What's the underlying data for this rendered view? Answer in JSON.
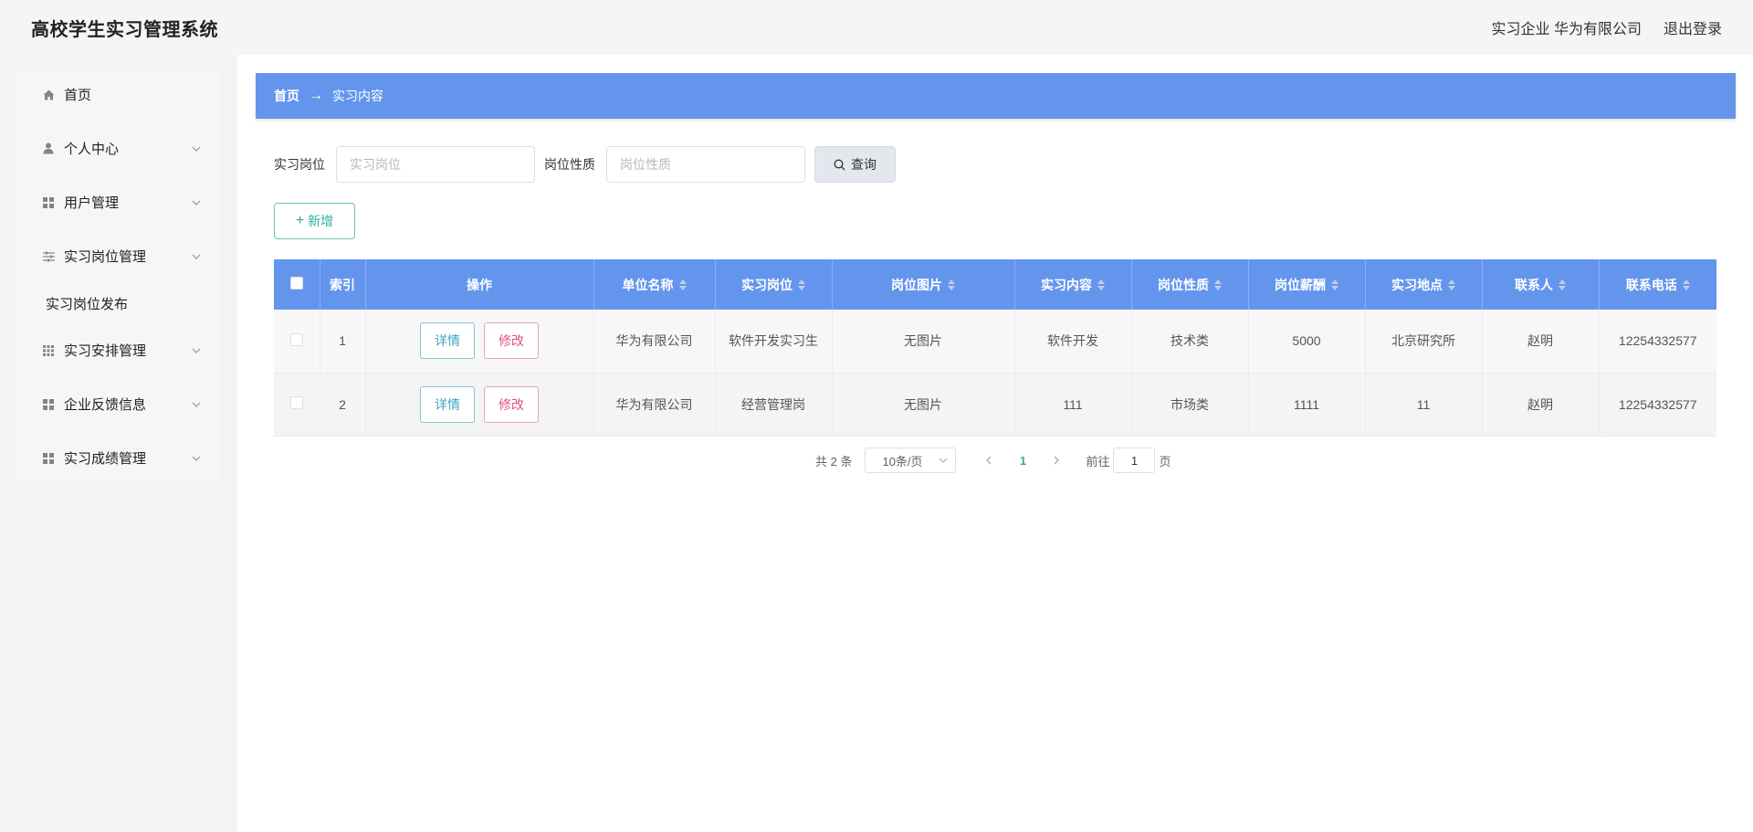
{
  "header": {
    "title": "高校学生实习管理系统",
    "user_info": "实习企业 华为有限公司",
    "logout": "退出登录"
  },
  "sidebar": {
    "items": [
      {
        "label": "首页",
        "icon": "home-icon",
        "has_children": false
      },
      {
        "label": "个人中心",
        "icon": "user-icon",
        "has_children": true
      },
      {
        "label": "用户管理",
        "icon": "grid-icon",
        "has_children": true
      },
      {
        "label": "实习岗位管理",
        "icon": "sliders-icon",
        "has_children": true,
        "expanded": true,
        "children": [
          "实习岗位发布"
        ]
      },
      {
        "label": "实习安排管理",
        "icon": "grid-small-icon",
        "has_children": true
      },
      {
        "label": "企业反馈信息",
        "icon": "grid-icon",
        "has_children": true
      },
      {
        "label": "实习成绩管理",
        "icon": "grid-icon",
        "has_children": true
      }
    ]
  },
  "breadcrumb": {
    "home": "首页",
    "separator": "→",
    "current": "实习内容"
  },
  "search": {
    "position_label": "实习岗位",
    "position_placeholder": "实习岗位",
    "position_value": "",
    "nature_label": "岗位性质",
    "nature_placeholder": "岗位性质",
    "nature_value": "",
    "query_button": "查询"
  },
  "actions": {
    "add_button": "新增"
  },
  "table": {
    "headers": [
      "索引",
      "操作",
      "单位名称",
      "实习岗位",
      "岗位图片",
      "实习内容",
      "岗位性质",
      "岗位薪酬",
      "实习地点",
      "联系人",
      "联系电话"
    ],
    "sortable": [
      false,
      false,
      true,
      true,
      true,
      true,
      true,
      true,
      true,
      true,
      true
    ],
    "detail_label": "详情",
    "edit_label": "修改",
    "rows": [
      {
        "index": "1",
        "company": "华为有限公司",
        "position": "软件开发实习生",
        "image": "无图片",
        "content": "软件开发",
        "nature": "技术类",
        "salary": "5000",
        "location": "北京研究所",
        "contact": "赵明",
        "phone": "12254332577"
      },
      {
        "index": "2",
        "company": "华为有限公司",
        "position": "经营管理岗",
        "image": "无图片",
        "content": "111",
        "nature": "市场类",
        "salary": "1111",
        "location": "11",
        "contact": "赵明",
        "phone": "12254332577"
      }
    ]
  },
  "pagination": {
    "total": "共 2 条",
    "page_size": "10条/页",
    "current_page": "1",
    "goto_label": "前往",
    "goto_value": "1",
    "page_suffix": "页"
  },
  "colors": {
    "primary": "#6495ed",
    "accent": "#2bb19d",
    "edit": "#e0508a"
  }
}
